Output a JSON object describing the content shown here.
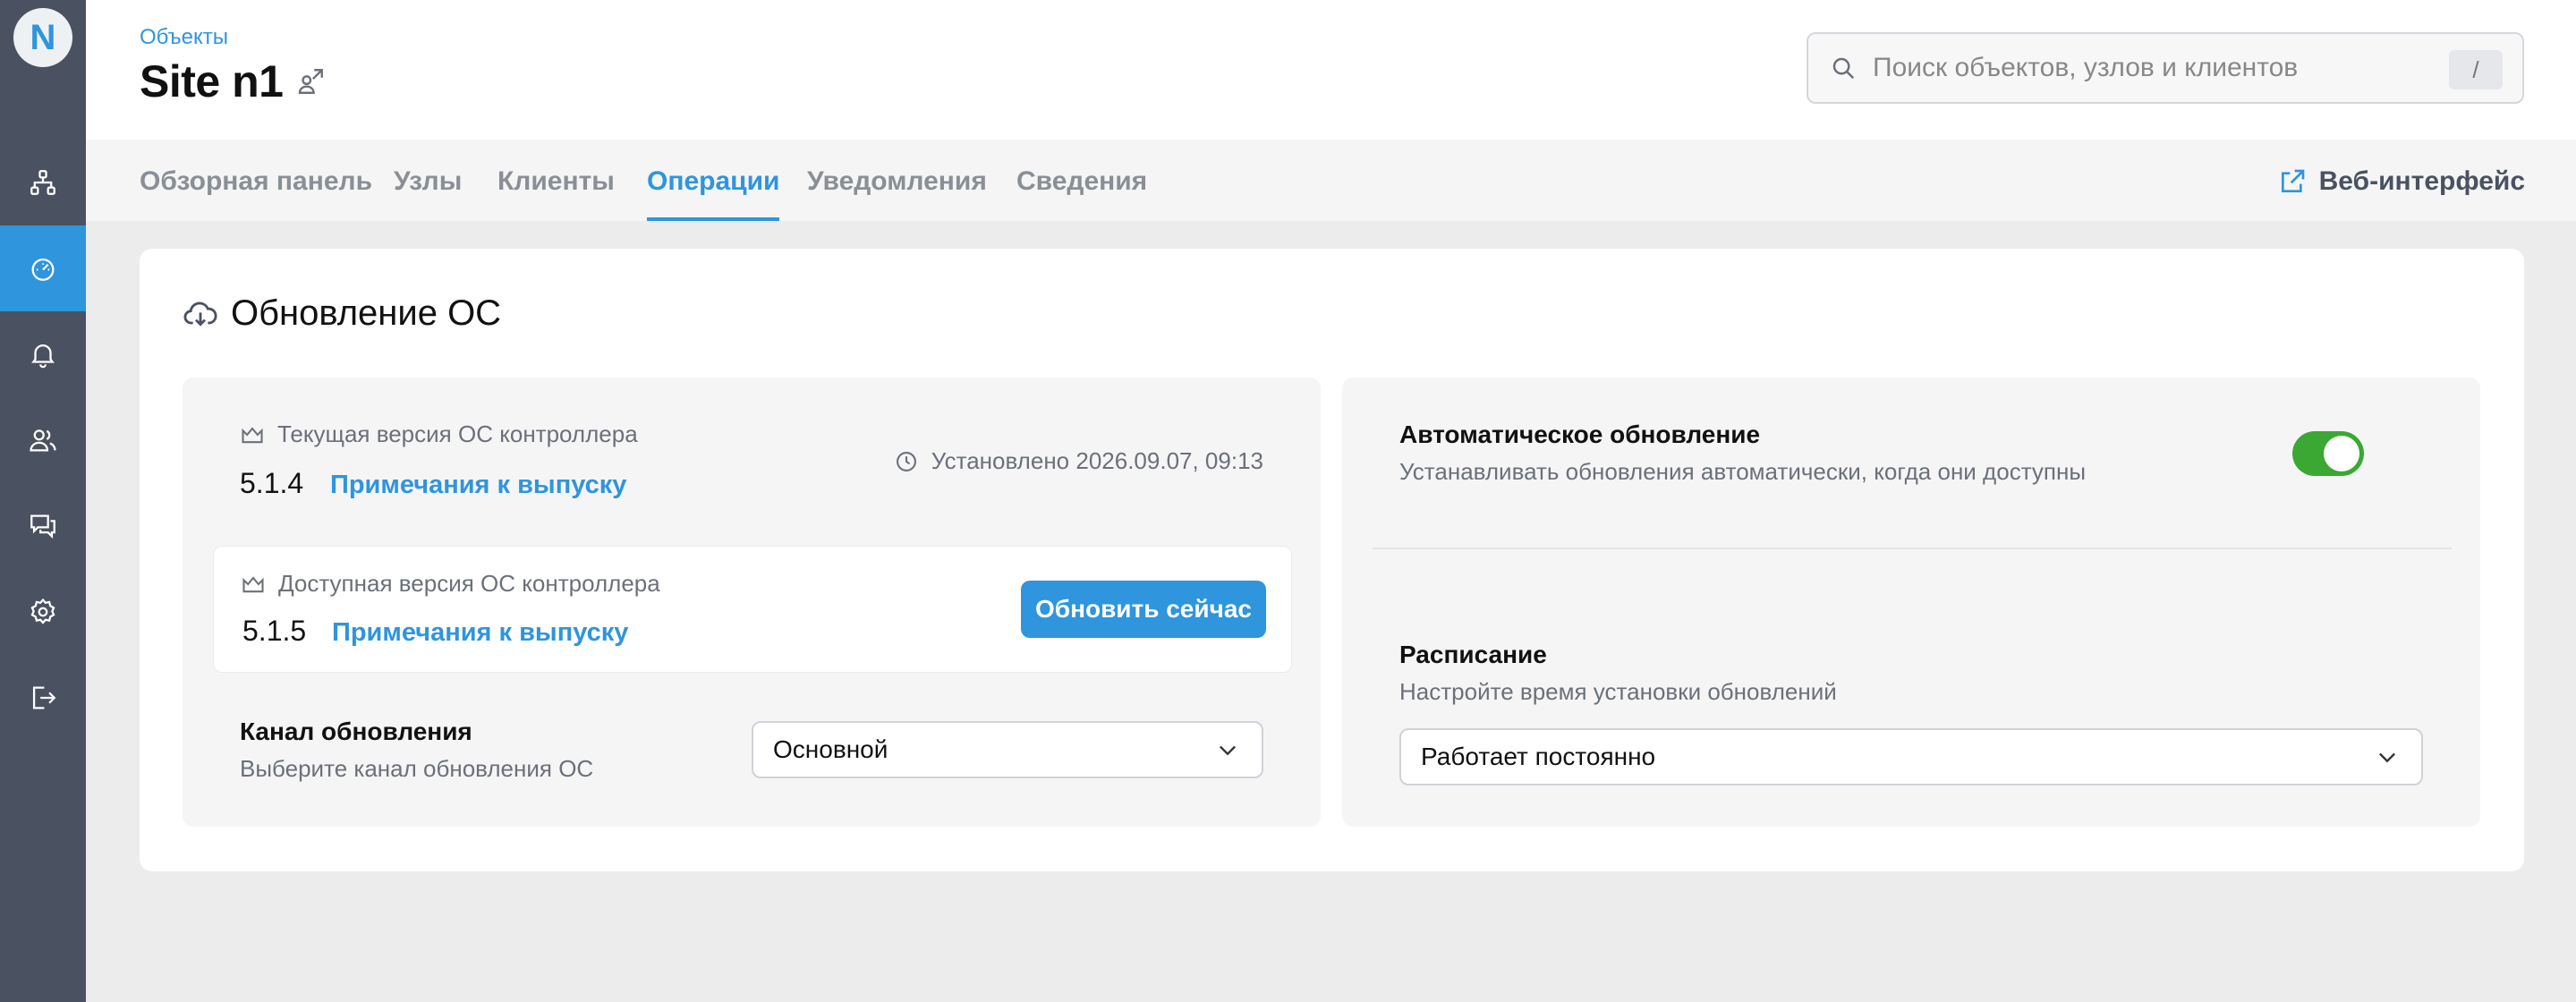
{
  "header": {
    "breadcrumb": "Объекты",
    "title": "Site n1",
    "search_placeholder": "Поиск объектов, узлов и клиентов",
    "search_shortcut": "/"
  },
  "tabs": [
    {
      "label": "Обзорная панель"
    },
    {
      "label": "Узлы"
    },
    {
      "label": "Клиенты"
    },
    {
      "label": "Операции",
      "active": true
    },
    {
      "label": "Уведомления"
    },
    {
      "label": "Сведения"
    }
  ],
  "web_interface_label": "Веб-интерфейс",
  "sidebar": {
    "logo": "N",
    "items": [
      {
        "icon": "network-icon"
      },
      {
        "icon": "dashboard-gauge-icon",
        "active": true
      },
      {
        "icon": "bell-icon"
      },
      {
        "icon": "users-icon"
      },
      {
        "icon": "chat-icon"
      },
      {
        "icon": "gear-icon"
      },
      {
        "icon": "logout-icon"
      }
    ]
  },
  "os_update": {
    "title": "Обновление ОС",
    "current": {
      "label": "Текущая версия ОС контроллера",
      "version": "5.1.4",
      "release_notes": "Примечания к выпуску",
      "installed": "Установлено 2026.09.07, 09:13"
    },
    "available": {
      "label": "Доступная версия ОС контроллера",
      "version": "5.1.5",
      "release_notes": "Примечания к выпуску",
      "update_button": "Обновить сейчас"
    },
    "channel": {
      "title": "Канал обновления",
      "subtitle": "Выберите канал обновления ОС",
      "value": "Основной"
    },
    "auto_update": {
      "title": "Автоматическое обновление",
      "subtitle": "Устанавливать обновления автоматически, когда они доступны",
      "enabled": true
    },
    "schedule": {
      "title": "Расписание",
      "subtitle": "Настройте время установки обновлений",
      "value": "Работает постоянно"
    }
  },
  "colors": {
    "accent": "#2f95dc",
    "sidebar": "#4a5261",
    "toggle_on": "#3aa832"
  }
}
